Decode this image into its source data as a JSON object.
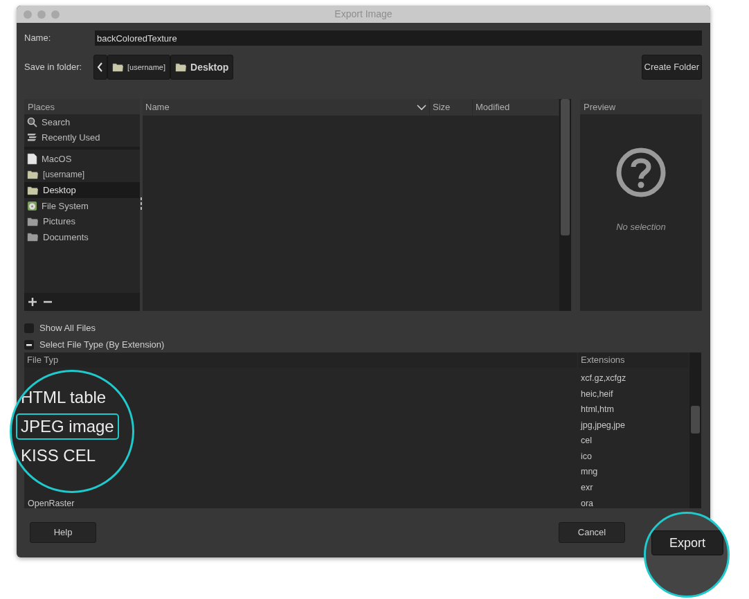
{
  "window": {
    "title": "Export Image"
  },
  "name_field": {
    "label": "Name:",
    "value": "backColoredTexture"
  },
  "save_folder": {
    "label": "Save in folder:",
    "path": [
      {
        "label": "[username]",
        "selected": false
      },
      {
        "label": "Desktop",
        "selected": true
      }
    ]
  },
  "create_folder": "Create Folder",
  "places": {
    "title": "Places",
    "groups": [
      [
        {
          "label": "Search",
          "kind": "search",
          "selected": false
        },
        {
          "label": "Recently Used",
          "kind": "recent",
          "selected": false
        }
      ],
      [
        {
          "label": "MacOS",
          "kind": "drive",
          "selected": false
        },
        {
          "label": "[username]",
          "kind": "folder",
          "selected": false
        },
        {
          "label": "Desktop",
          "kind": "folder",
          "selected": true
        },
        {
          "label": "File System",
          "kind": "filesystem",
          "selected": false
        },
        {
          "label": "Pictures",
          "kind": "plainfolder",
          "selected": false
        },
        {
          "label": "Documents",
          "kind": "plainfolder",
          "selected": false
        }
      ]
    ]
  },
  "file_list": {
    "columns": [
      "Name",
      "Size",
      "Modified"
    ]
  },
  "preview": {
    "title": "Preview",
    "message": "No selection"
  },
  "show_all_files": {
    "label": "Show All Files",
    "checked": false
  },
  "file_type_expander": {
    "label": "Select File Type (By Extension)",
    "expanded": true
  },
  "file_types": {
    "columns": [
      "File Typ",
      "Extensions"
    ],
    "rows": [
      {
        "extensions": "xcf.gz,xcfgz"
      },
      {
        "extensions": "heic,heif"
      },
      {
        "extensions": "html,htm"
      },
      {
        "extensions": "jpg,jpeg,jpe"
      },
      {
        "extensions": "cel"
      },
      {
        "extensions": "ico"
      },
      {
        "extensions": "mng"
      },
      {
        "extensions": "exr"
      },
      {
        "name": "OpenRaster",
        "extensions": "ora"
      }
    ]
  },
  "magnifier": {
    "items": [
      {
        "label": "HTML table",
        "selected": false
      },
      {
        "label": "JPEG image",
        "selected": true
      },
      {
        "label": "KISS CEL",
        "selected": false
      }
    ]
  },
  "buttons": {
    "help": "Help",
    "cancel": "Cancel",
    "export": "Export"
  }
}
